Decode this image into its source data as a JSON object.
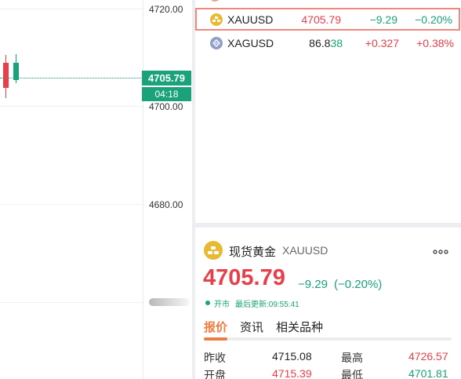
{
  "chart": {
    "price_axis": [
      "4720.00",
      "4700.00",
      "4680.00"
    ],
    "current_price": "4705.79",
    "countdown": "04:18",
    "colors": {
      "up": "#1aa37a",
      "down": "#e8404a"
    }
  },
  "watchlist": {
    "rows": [
      {
        "icon": "gold-coin-icon",
        "symbol": "XAUUSD",
        "price": "4705.79",
        "price_main": "4705.79",
        "price_tail": "",
        "change": "−9.29",
        "pct": "−0.20%"
      },
      {
        "icon": "silver-coin-icon",
        "symbol": "XAGUSD",
        "price": "86.838",
        "price_main": "86.8",
        "price_tail": "38",
        "change": "+0.327",
        "pct": "+0.38%"
      }
    ]
  },
  "detail": {
    "name": "现货黄金",
    "symbol": "XAUUSD",
    "more": "∘∘∘",
    "price": "4705.79",
    "change": "−9.29",
    "change_pct": "(−0.20%)",
    "status": "开市",
    "last_update": "最后更新:09:55:41",
    "tabs": [
      "报价",
      "资讯",
      "相关品种"
    ],
    "stats": [
      {
        "label": "昨收",
        "value": "4715.08"
      },
      {
        "label": "最高",
        "value": "4726.57"
      },
      {
        "label": "开盘",
        "value": "4715.39"
      },
      {
        "label": "最低",
        "value": "4701.81"
      }
    ]
  }
}
